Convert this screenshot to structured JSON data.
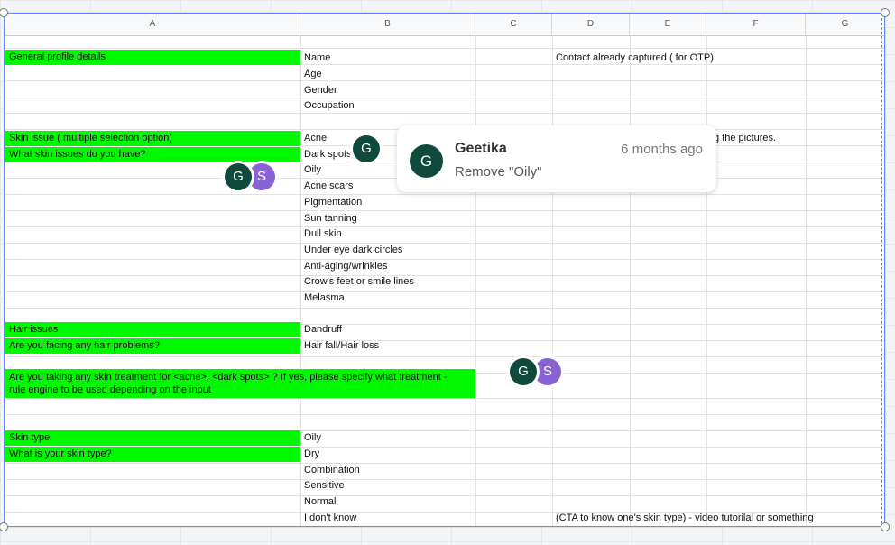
{
  "columns": [
    "A",
    "B",
    "C",
    "D",
    "E",
    "F",
    "G"
  ],
  "rows": {
    "general_label": "General profile details",
    "b_name": "Name",
    "d_contact": "Contact already captured ( for OTP)",
    "b_age": "Age",
    "b_gender": "Gender",
    "b_occupation": "Occupation",
    "skin_issue_label": "Skin issue ( multiple selection option)",
    "skin_issue_question": "What skin issues do you have?",
    "b_acne": "Acne",
    "d_pictures": "g the pictures.",
    "b_dark_spots": "Dark spots",
    "b_oily": "Oily",
    "b_acne_scars": "Acne scars",
    "b_pigmentation": "Pigmentation",
    "b_sun_tanning": "Sun tanning",
    "b_dull_skin": "Dull skin",
    "b_under_eye": "Under eye dark circles",
    "b_anti_aging": "Anti-aging/wrinkles",
    "b_crows_feet": "Crow's feet or smile lines",
    "b_melasma": "Melasma",
    "hair_label": "Hair issues",
    "hair_question": "Are you facing any hair problems?",
    "b_dandruff": "Dandruff",
    "b_hair_fall": "Hair fall/Hair loss",
    "treatment_line1": "Are you taking any skin treatment for <acne>, <dark spots> ? If yes, please specify what treatment -",
    "treatment_line2": "rule engine to be used depending on the input",
    "skin_type_label": "Skin type",
    "skin_type_question": "What is your skin type?",
    "b_st_oily": "Oily",
    "b_st_dry": "Dry",
    "b_st_combination": "Combination",
    "b_st_sensitive": "Sensitive",
    "b_st_normal": "Normal",
    "b_st_dont_know": "I don't know",
    "d_cta": "(CTA to know one's skin type) - video tutorilal or something"
  },
  "avatars": {
    "g": "G",
    "s": "S"
  },
  "comment": {
    "author": "Geetika",
    "time": "6 months ago",
    "text": "Remove \"Oily\"",
    "avatar_letter": "G"
  },
  "colors": {
    "highlight": "#00f900",
    "avatar_g": "#0f4a3c",
    "avatar_s": "#8a63d2",
    "selection": "#6a86f2"
  }
}
